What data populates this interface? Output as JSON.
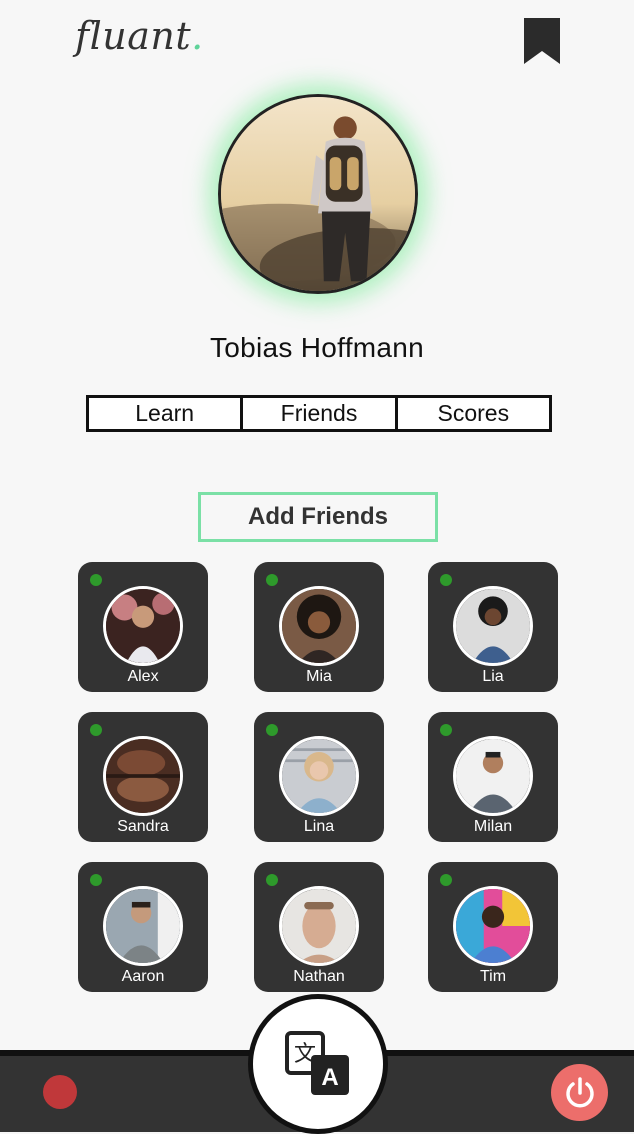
{
  "app": {
    "logo_text": "fluant",
    "logo_dot": ".",
    "bookmark_icon": "bookmark-icon"
  },
  "profile": {
    "name": "Tobias Hoffmann",
    "glow_color": "#7be096"
  },
  "tabs": [
    {
      "label": "Learn"
    },
    {
      "label": "Friends"
    },
    {
      "label": "Scores"
    }
  ],
  "add_friends_label": "Add Friends",
  "friends": [
    {
      "name": "Alex",
      "online": true
    },
    {
      "name": "Mia",
      "online": true
    },
    {
      "name": "Lia",
      "online": true
    },
    {
      "name": "Sandra",
      "online": true
    },
    {
      "name": "Lina",
      "online": true
    },
    {
      "name": "Milan",
      "online": true
    },
    {
      "name": "Aaron",
      "online": true
    },
    {
      "name": "Nathan",
      "online": true
    },
    {
      "name": "Tim",
      "online": true
    }
  ],
  "bottom_bar": {
    "record_icon": "record-icon",
    "translate_icon": "translate-icon",
    "translate_glyph": "A",
    "power_icon": "power-icon"
  },
  "colors": {
    "accent": "#5fd39a",
    "card_bg": "#333333",
    "status_online": "#2e9a2b",
    "record": "#c0383a",
    "power": "#ec6e6b"
  }
}
